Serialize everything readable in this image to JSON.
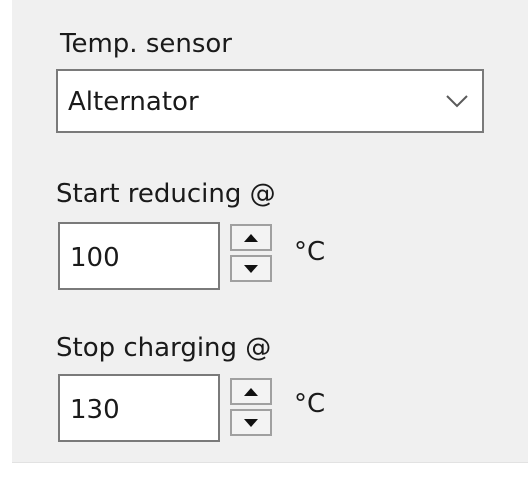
{
  "temp_sensor": {
    "label": "Temp. sensor",
    "selected": "Alternator"
  },
  "start_reducing": {
    "label": "Start reducing @",
    "value": "100",
    "unit": "°C"
  },
  "stop_charging": {
    "label": "Stop charging @",
    "value": "130",
    "unit": "°C"
  }
}
